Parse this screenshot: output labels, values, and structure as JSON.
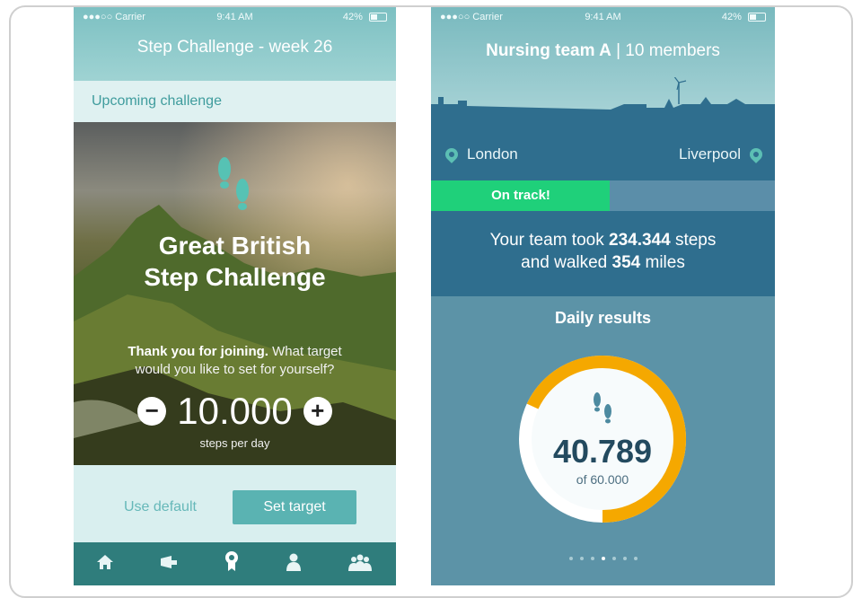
{
  "phone1": {
    "status": {
      "carrier": "●●●○○ Carrier",
      "time": "9:41 AM",
      "battery": "42%"
    },
    "title": "Step Challenge - week 26",
    "subbar": "Upcoming challenge",
    "hero_title_line1": "Great British",
    "hero_title_line2": "Step Challenge",
    "question_bold": "Thank you for joining.",
    "question_rest": " What target",
    "question_line2": "would you like to set for yourself?",
    "target_value": "10.000",
    "steps_label": "steps per day",
    "use_default": "Use default",
    "set_target": "Set target",
    "tabs": [
      "home-icon",
      "megaphone-icon",
      "award-icon",
      "person-icon",
      "group-icon"
    ],
    "accent": "#5ab3b2"
  },
  "phone2": {
    "status": {
      "carrier": "●●●○○ Carrier",
      "time": "9:41 AM",
      "battery": "42%"
    },
    "team_name": "Nursing team A",
    "team_members": " | 10 members",
    "from": "London",
    "to": "Liverpool",
    "progress_label": "On track!",
    "progress_fraction": 0.52,
    "line1_pre": "Your team took ",
    "line1_value": "234.344",
    "line1_post": " steps",
    "line2_pre": "and walked ",
    "line2_value": "354",
    "line2_post": " miles",
    "daily_title": "Daily results",
    "daily_value": "40.789",
    "daily_goal": "of 60.000",
    "ring_fraction": 0.68,
    "page_dots": 7,
    "active_dot": 3,
    "ring_color": "#f5a800",
    "track_color": "#1fd07a"
  }
}
